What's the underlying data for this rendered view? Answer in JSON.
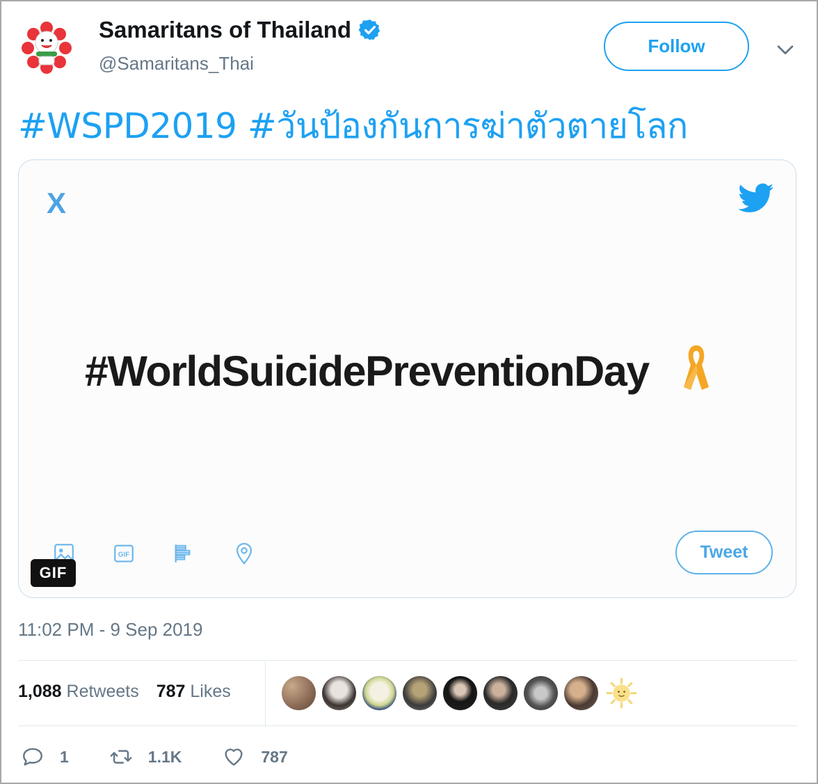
{
  "author": {
    "display_name": "Samaritans of Thailand",
    "handle": "@Samaritans_Thai",
    "verified": true
  },
  "follow_label": "Follow",
  "tweet": {
    "hashtags": [
      "#WSPD2019",
      "#วันป้องกันการฆ่าตัวตายโลก"
    ]
  },
  "media": {
    "close_label": "X",
    "headline": "#WorldSuicidePreventionDay",
    "tweet_button_label": "Tweet",
    "toolbar_icons": [
      "image-icon",
      "gif-icon",
      "poll-icon",
      "location-icon"
    ],
    "badge": "GIF"
  },
  "timestamp": "11:02 PM - 9 Sep 2019",
  "stats": {
    "retweets_count": "1,088",
    "retweets_label": "Retweets",
    "likes_count": "787",
    "likes_label": "Likes"
  },
  "actions": {
    "replies": "1",
    "retweets": "1.1K",
    "likes": "787"
  },
  "colors": {
    "twitter_blue": "#1da1f2",
    "text_primary": "#14171a",
    "text_secondary": "#657786",
    "ribbon": "#f5a623"
  }
}
